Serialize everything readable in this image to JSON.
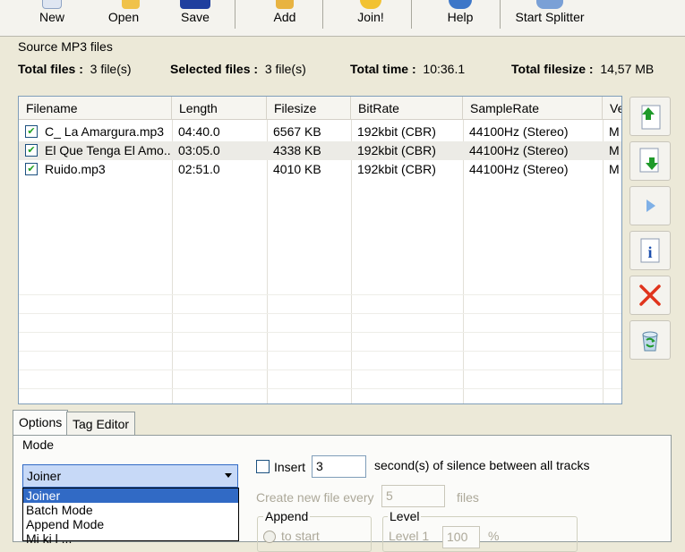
{
  "toolbar": {
    "buttons": [
      {
        "label": "New",
        "icon": "new-file-icon"
      },
      {
        "label": "Open",
        "icon": "open-folder-icon"
      },
      {
        "label": "Save",
        "icon": "save-disk-icon"
      },
      {
        "label": "Add",
        "icon": "add-file-icon"
      },
      {
        "label": "Join!",
        "icon": "join-icon"
      },
      {
        "label": "Help",
        "icon": "help-icon"
      },
      {
        "label": "Start Splitter",
        "icon": "splitter-icon"
      }
    ]
  },
  "source": {
    "group_title": "Source MP3 files",
    "total_files_label": "Total files :",
    "total_files_value": "3 file(s)",
    "selected_files_label": "Selected files :",
    "selected_files_value": "3 file(s)",
    "total_time_label": "Total time :",
    "total_time_value": "10:36.1",
    "total_filesize_label": "Total filesize :",
    "total_filesize_value": "14,57 MB"
  },
  "grid": {
    "columns": [
      "Filename",
      "Length",
      "Filesize",
      "BitRate",
      "SampleRate",
      "Ve"
    ],
    "rows": [
      {
        "checked": true,
        "cells": [
          "C_ La Amargura.mp3",
          "04:40.0",
          "6567 KB",
          "192kbit (CBR)",
          "44100Hz (Stereo)",
          "M"
        ]
      },
      {
        "checked": true,
        "cells": [
          "El Que Tenga El Amo...",
          "03:05.0",
          "4338 KB",
          "192kbit (CBR)",
          "44100Hz (Stereo)",
          "M"
        ]
      },
      {
        "checked": true,
        "cells": [
          "Ruido.mp3",
          "02:51.0",
          "4010 KB",
          "192kbit (CBR)",
          "44100Hz (Stereo)",
          "M"
        ]
      }
    ]
  },
  "side_buttons": [
    "move-up-icon",
    "move-down-icon",
    "play-icon",
    "info-icon",
    "delete-icon",
    "recycle-icon"
  ],
  "tabs": [
    "Options",
    "Tag Editor"
  ],
  "options": {
    "mode_label": "Mode",
    "mode_value": "Joiner",
    "mode_options": [
      "Joiner",
      "Batch Mode",
      "Append Mode",
      "Mi ki  l ..."
    ],
    "insert_label": "Insert",
    "insert_value": "3",
    "silence_label": "second(s) of silence between all tracks",
    "create_new_label": "Create new file every",
    "create_new_value": "5",
    "files_label": "files",
    "append_label": "Append",
    "append_option": "to start",
    "level_label": "Level",
    "level_sub": "Level 1",
    "level_value": "100",
    "level_unit": "%"
  },
  "colors": {
    "accent": "#316ac5",
    "arrow_green": "#1f9a2a",
    "delete_red": "#e0341c",
    "info_blue": "#1c4fae"
  }
}
